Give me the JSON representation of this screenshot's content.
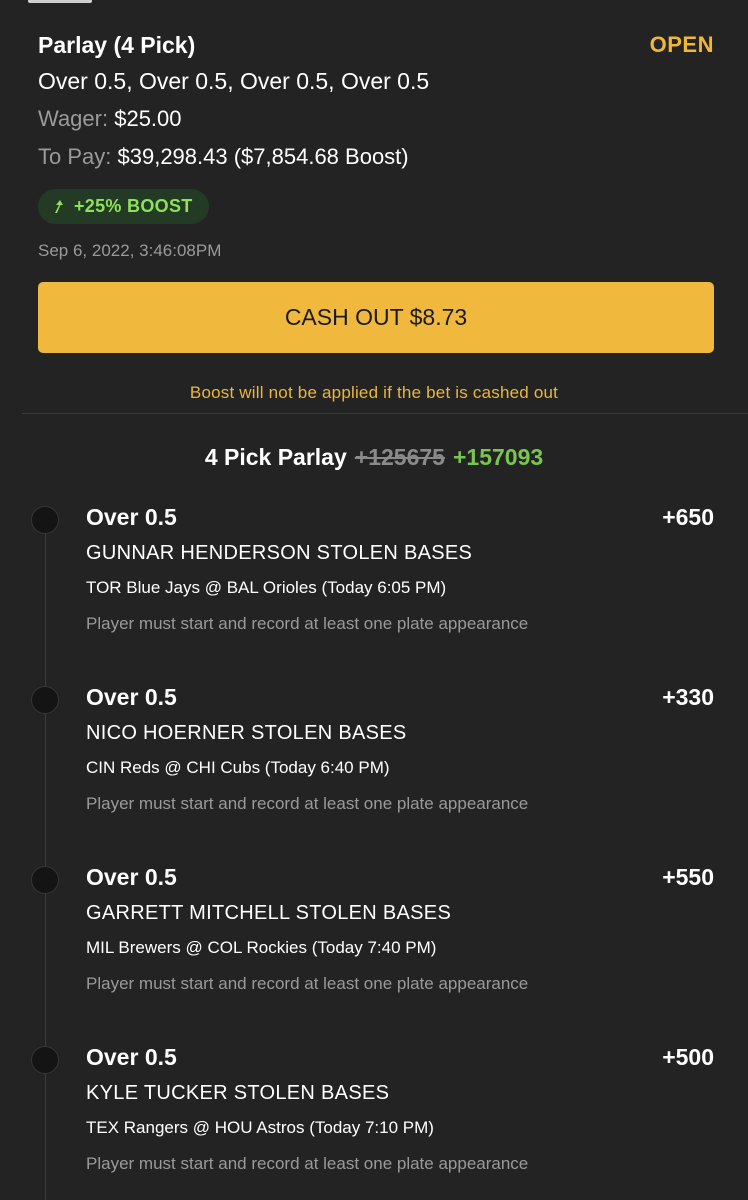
{
  "bet": {
    "title": "Parlay (4 Pick)",
    "status": "OPEN",
    "picks_summary": "Over 0.5, Over 0.5, Over 0.5, Over 0.5",
    "wager_label": "Wager:",
    "wager_value": "$25.00",
    "to_pay_label": "To Pay:",
    "to_pay_value": "$39,298.43 ($7,854.68 Boost)",
    "boost_badge": "+25% BOOST",
    "timestamp": "Sep 6, 2022, 3:46:08PM"
  },
  "cashout": {
    "button_label": "CASH OUT $8.73",
    "note": "Boost will not be applied if the bet is cashed out"
  },
  "parlay": {
    "label": "4 Pick Parlay",
    "old_odds": "+125675",
    "new_odds": "+157093"
  },
  "legs": [
    {
      "market": "Over 0.5",
      "odds": "+650",
      "player": "GUNNAR HENDERSON STOLEN BASES",
      "game": "TOR Blue Jays @ BAL Orioles (Today 6:05 PM)",
      "rule": "Player must start and record at least one plate appearance"
    },
    {
      "market": "Over 0.5",
      "odds": "+330",
      "player": "NICO HOERNER STOLEN BASES",
      "game": "CIN Reds @ CHI Cubs (Today 6:40 PM)",
      "rule": "Player must start and record at least one plate appearance"
    },
    {
      "market": "Over 0.5",
      "odds": "+550",
      "player": "GARRETT MITCHELL STOLEN BASES",
      "game": "MIL Brewers @ COL Rockies (Today 7:40 PM)",
      "rule": "Player must start and record at least one plate appearance"
    },
    {
      "market": "Over 0.5",
      "odds": "+500",
      "player": "KYLE TUCKER STOLEN BASES",
      "game": "TEX Rangers @ HOU Astros (Today 7:10 PM)",
      "rule": "Player must start and record at least one plate appearance"
    }
  ],
  "colors": {
    "background": "#232323",
    "status_open": "#f0b733",
    "cashout_button": "#f0b93e",
    "boost_text": "#8fe05a",
    "new_odds": "#79c54f"
  },
  "icons": {
    "boost": "arrow-up-right-icon",
    "leg_marker": "timeline-dot-icon"
  }
}
